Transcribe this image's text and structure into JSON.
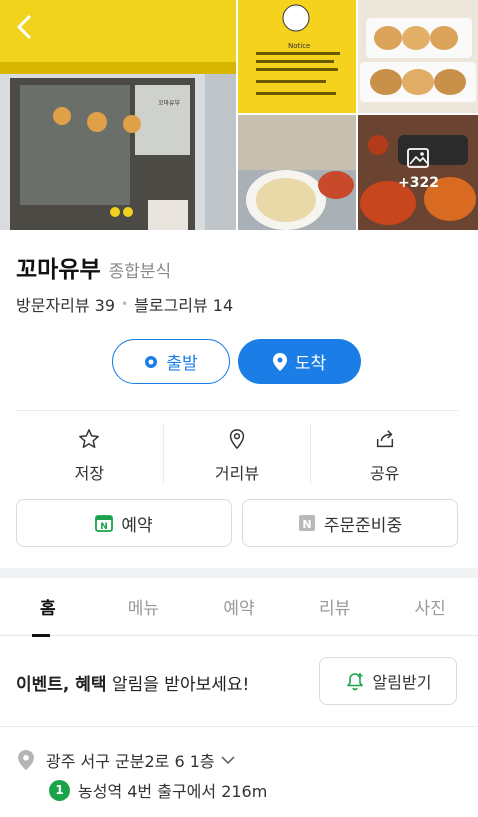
{
  "photos": {
    "sign_text": "꼬마유부",
    "notice_heading": "Notice",
    "more_count": "+322"
  },
  "place": {
    "name": "꼬마유부",
    "category": "종합분식",
    "visitor_reviews": "방문자리뷰 39",
    "blog_reviews": "블로그리뷰 14"
  },
  "route": {
    "start_label": "출발",
    "arrive_label": "도착"
  },
  "actions": [
    {
      "label": "저장",
      "icon": "star-icon"
    },
    {
      "label": "거리뷰",
      "icon": "location-pin-icon"
    },
    {
      "label": "공유",
      "icon": "share-icon"
    }
  ],
  "services": {
    "reserve_label": "예약",
    "order_label": "주문준비중"
  },
  "tabs": [
    {
      "label": "홈",
      "active": true
    },
    {
      "label": "메뉴",
      "active": false
    },
    {
      "label": "예약",
      "active": false
    },
    {
      "label": "리뷰",
      "active": false
    },
    {
      "label": "사진",
      "active": false
    }
  ],
  "alarm": {
    "bold_text": "이벤트, 혜택",
    "text": " 알림을 받아보세요!",
    "button_label": "알림받기"
  },
  "address": {
    "text": "광주 서구 군분2로 6 1층",
    "subway_line": "1",
    "subway_text": "농성역 4번 출구에서 216m"
  },
  "colors": {
    "accent": "#1a7ee6",
    "naver_green": "#1aa34a",
    "awning_yellow": "#f4d21e"
  }
}
